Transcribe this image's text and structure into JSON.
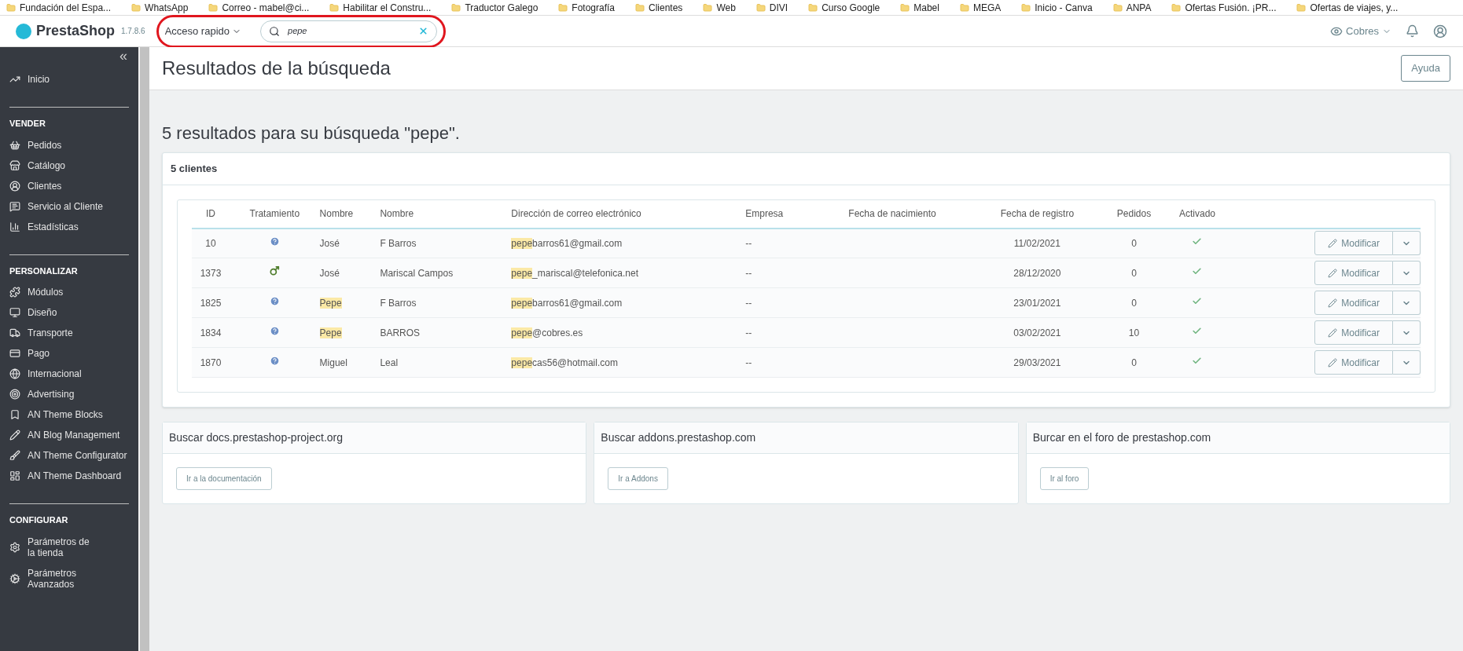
{
  "bookmarks": [
    "Fundación del Espa...",
    "WhatsApp",
    "Correo - mabel@ci...",
    "Habilitar el Constru...",
    "Traductor Galego",
    "Fotografía",
    "Clientes",
    "Web",
    "DIVI",
    "Curso Google",
    "Mabel",
    "MEGA",
    "Inicio - Canva",
    "ANPA",
    "Ofertas Fusión. ¡PR...",
    "Ofertas de viajes, y..."
  ],
  "header": {
    "brand": "PrestaShop",
    "version": "1.7.8.6",
    "quick_access": "Acceso rapido",
    "search_value": "pepe",
    "shop": "Cobres"
  },
  "sidebar": {
    "collapse": "«",
    "sections": [
      {
        "items": [
          "Inicio"
        ]
      },
      {
        "title": "VENDER",
        "items": [
          "Pedidos",
          "Catálogo",
          "Clientes",
          "Servicio al Cliente",
          "Estadísticas"
        ]
      },
      {
        "title": "PERSONALIZAR",
        "items": [
          "Módulos",
          "Diseño",
          "Transporte",
          "Pago",
          "Internacional",
          "Advertising",
          "AN Theme Blocks",
          "AN Blog Management",
          "AN Theme Configurator",
          "AN Theme Dashboard"
        ]
      },
      {
        "title": "CONFIGURAR",
        "items": [
          "Parámetros de la tienda",
          "Parámetros Avanzados"
        ]
      }
    ]
  },
  "page": {
    "title": "Resultados de la búsqueda",
    "help": "Ayuda",
    "summary": "5 resultados para su búsqueda \"pepe\"."
  },
  "clients": {
    "title": "5 clientes",
    "columns": [
      "ID",
      "Tratamiento",
      "Nombre",
      "Nombre",
      "Dirección de correo electrónico",
      "Empresa",
      "Fecha de nacimiento",
      "Fecha de registro",
      "Pedidos",
      "Activado"
    ],
    "rows": [
      {
        "id": "10",
        "kind": "unknown",
        "action": "Modificar",
        "first": "José",
        "first_match": false,
        "last": "F Barros",
        "email": "**pepe**barros61@gmail.com",
        "company": "--",
        "registered": "11/02/2021",
        "orders": "0",
        "active": true
      },
      {
        "id": "1373",
        "kind": "male",
        "action": "Modificar",
        "first": "José",
        "first_match": false,
        "last": "Mariscal Campos",
        "email": "**pepe**_mariscal@telefonica.net",
        "company": "--",
        "registered": "28/12/2020",
        "orders": "0",
        "active": true
      },
      {
        "id": "1825",
        "kind": "unknown",
        "action": "Modificar",
        "first": "Pepe",
        "first_match": true,
        "last": "F Barros",
        "email": "**pepe**barros61@gmail.com",
        "company": "--",
        "registered": "23/01/2021",
        "orders": "0",
        "active": true
      },
      {
        "id": "1834",
        "kind": "unknown",
        "action": "Modificar",
        "first": "Pepe",
        "first_match": true,
        "last": "BARROS",
        "email": "**pepe**@cobres.es",
        "company": "--",
        "registered": "03/02/2021",
        "orders": "10",
        "active": true
      },
      {
        "id": "1870",
        "kind": "unknown",
        "action": "Modificar",
        "first": "Miguel",
        "first_match": false,
        "last": "Leal",
        "email": "**pepe**cas56@hotmail.com",
        "company": "--",
        "registered": "29/03/2021",
        "orders": "0",
        "active": true
      }
    ]
  },
  "links": [
    {
      "title": "Buscar docs.prestashop-project.org",
      "button": "Ir a la documentación"
    },
    {
      "title": "Buscar addons.prestashop.com",
      "button": "Ir a Addons"
    },
    {
      "title": "Burcar en el foro de prestashop.com",
      "button": "Ir al foro"
    }
  ]
}
